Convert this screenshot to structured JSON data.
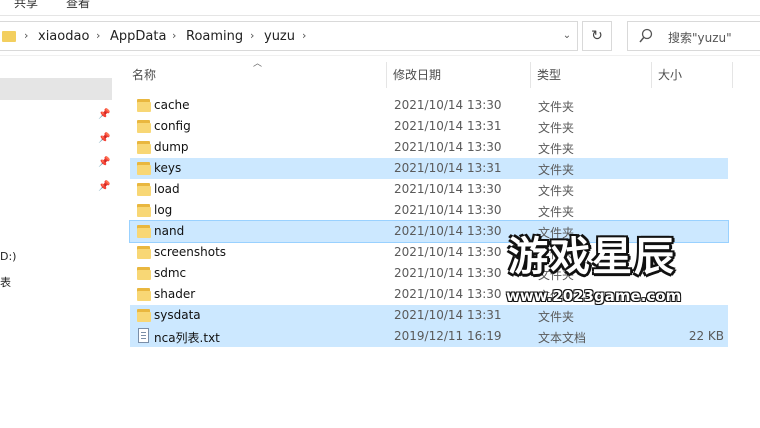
{
  "ribbon": {
    "tabs": [
      "共享",
      "查看"
    ]
  },
  "breadcrumb": [
    "xiaodao",
    "AppData",
    "Roaming",
    "yuzu"
  ],
  "search": {
    "placeholder": "搜索\"yuzu\""
  },
  "nav": {
    "items": [
      "D:)",
      "表"
    ]
  },
  "columns": {
    "name": "名称",
    "date": "修改日期",
    "type": "类型",
    "size": "大小"
  },
  "files": [
    {
      "name": "cache",
      "date": "2021/10/14 13:30",
      "type": "文件夹",
      "size": "",
      "kind": "folder",
      "selected": false
    },
    {
      "name": "config",
      "date": "2021/10/14 13:31",
      "type": "文件夹",
      "size": "",
      "kind": "folder",
      "selected": false
    },
    {
      "name": "dump",
      "date": "2021/10/14 13:30",
      "type": "文件夹",
      "size": "",
      "kind": "folder",
      "selected": false
    },
    {
      "name": "keys",
      "date": "2021/10/14 13:31",
      "type": "文件夹",
      "size": "",
      "kind": "folder",
      "selected": true
    },
    {
      "name": "load",
      "date": "2021/10/14 13:30",
      "type": "文件夹",
      "size": "",
      "kind": "folder",
      "selected": false
    },
    {
      "name": "log",
      "date": "2021/10/14 13:30",
      "type": "文件夹",
      "size": "",
      "kind": "folder",
      "selected": false
    },
    {
      "name": "nand",
      "date": "2021/10/14 13:30",
      "type": "文件夹",
      "size": "",
      "kind": "folder",
      "selected": true
    },
    {
      "name": "screenshots",
      "date": "2021/10/14 13:30",
      "type": "文件夹",
      "size": "",
      "kind": "folder",
      "selected": false
    },
    {
      "name": "sdmc",
      "date": "2021/10/14 13:30",
      "type": "文件夹",
      "size": "",
      "kind": "folder",
      "selected": false
    },
    {
      "name": "shader",
      "date": "2021/10/14 13:30",
      "type": "文件夹",
      "size": "",
      "kind": "folder",
      "selected": false
    },
    {
      "name": "sysdata",
      "date": "2021/10/14 13:31",
      "type": "文件夹",
      "size": "",
      "kind": "folder",
      "selected": true
    },
    {
      "name": "nca列表.txt",
      "date": "2019/12/11 16:19",
      "type": "文本文档",
      "size": "22 KB",
      "kind": "text",
      "selected": true
    }
  ],
  "watermark": {
    "title": "游戏星辰",
    "url": "www.2023game.com"
  },
  "colors": {
    "selection": "#cce8ff",
    "folder": "#f8d775",
    "nav_selected": "#e5e5e5"
  }
}
